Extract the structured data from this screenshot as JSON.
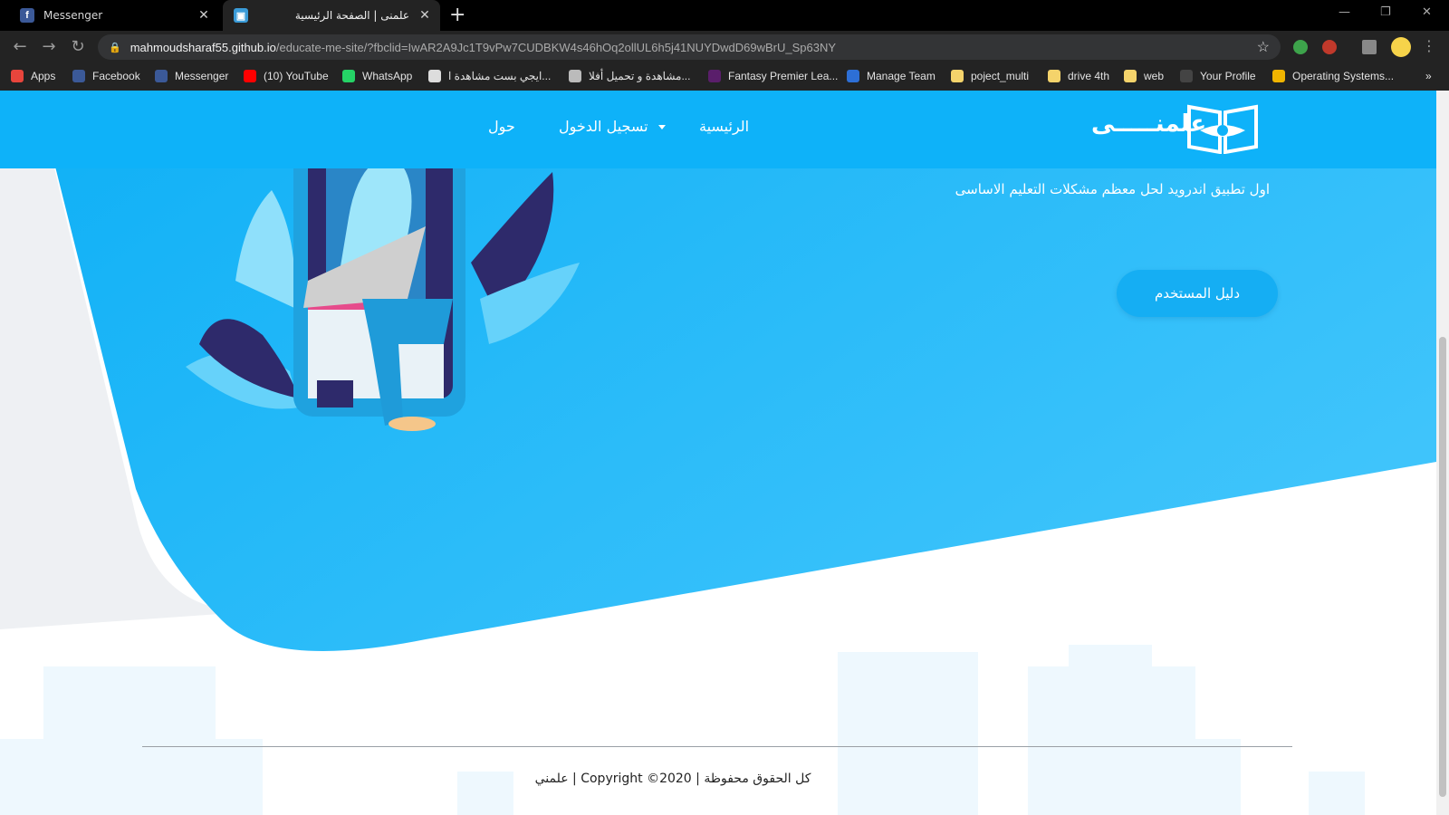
{
  "browser": {
    "tabs": [
      {
        "title": "Messenger",
        "favicon": "facebook-icon"
      },
      {
        "title": "علمنى | الصفحة الرئيسية",
        "favicon": "site-icon"
      }
    ],
    "url_host": "mahmoudsharaf55.github.io",
    "url_path": "/educate-me-site/?fbclid=IwAR2A9Jc1T9vPw7CUDBKW4s46hOq2ollUL6h5j41NUYDwdD69wBrU_Sp63NY",
    "bookmarks": [
      {
        "label": "Apps",
        "icon": "apps-grid-icon",
        "color": "#e8453c"
      },
      {
        "label": "Facebook",
        "icon": "facebook-icon",
        "color": "#3b5998"
      },
      {
        "label": "Messenger",
        "icon": "facebook-icon",
        "color": "#3b5998"
      },
      {
        "label": "(10) YouTube",
        "icon": "youtube-icon",
        "color": "#ff0000"
      },
      {
        "label": "WhatsApp",
        "icon": "whatsapp-icon",
        "color": "#25d366"
      },
      {
        "label": "ايجي بست مشاهدة ا...",
        "icon": "egybest-icon",
        "color": "#dddddd"
      },
      {
        "label": "مشاهدة و تحميل أفلا...",
        "icon": "globe-icon",
        "color": "#bbbbbb"
      },
      {
        "label": "Fantasy Premier Lea...",
        "icon": "premier-league-icon",
        "color": "#5a1e6b"
      },
      {
        "label": "Manage Team",
        "icon": "team-icon",
        "color": "#2d6fd6"
      },
      {
        "label": "poject_multi",
        "icon": "folder-icon",
        "color": "#f4d36b"
      },
      {
        "label": "drive 4th",
        "icon": "folder-icon",
        "color": "#f4d36b"
      },
      {
        "label": "web",
        "icon": "folder-icon",
        "color": "#f4d36b"
      },
      {
        "label": "Your Profile",
        "icon": "github-icon",
        "color": "#444444"
      },
      {
        "label": "Operating Systems...",
        "icon": "os-icon",
        "color": "#f0b400"
      }
    ],
    "more_bookmarks": "»"
  },
  "site": {
    "nav": {
      "logo_text": "علمنـــــى",
      "home": "الرئيسية",
      "login": "تسجيل الدخول",
      "about": "حول"
    },
    "hero": {
      "tagline": "اول تطبيق اندرويد لحل معظم مشكلات التعليم الاساسى",
      "guide_button": "دليل المستخدم"
    },
    "footer": {
      "copyright": "علمني | Copyright ©2020 | كل الحقوق محفوظة"
    }
  },
  "colors": {
    "brand_blue": "#0eb2f9",
    "shape_blue": "#22b6f6",
    "light_gray": "#eef0f3"
  }
}
